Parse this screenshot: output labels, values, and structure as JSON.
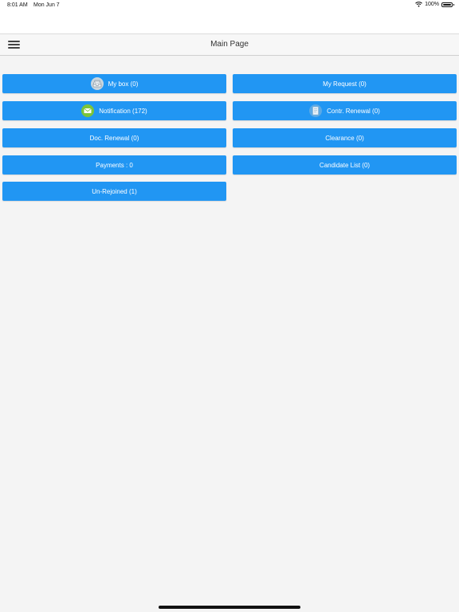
{
  "status_bar": {
    "time": "8:01 AM",
    "date": "Mon Jun 7",
    "battery": "100%"
  },
  "nav": {
    "title": "Main Page"
  },
  "tiles": {
    "my_box": "My box (0)",
    "my_request": "My Request (0)",
    "notification": "Notification (172)",
    "contr_renewal": "Contr. Renewal (0)",
    "doc_renewal": "Doc. Renewal (0)",
    "clearance": "Clearance (0)",
    "payments": "Payments : 0",
    "candidate_list": "Candidate List (0)",
    "un_rejoined": "Un-Rejoined (1)"
  },
  "icons": {
    "my_box": "inbox-tray-icon",
    "notification": "envelope-icon",
    "contr_renewal": "document-icon"
  },
  "colors": {
    "tile_blue": "#2196f3",
    "background": "#f4f4f4",
    "notification_green": "#7cc43a"
  }
}
